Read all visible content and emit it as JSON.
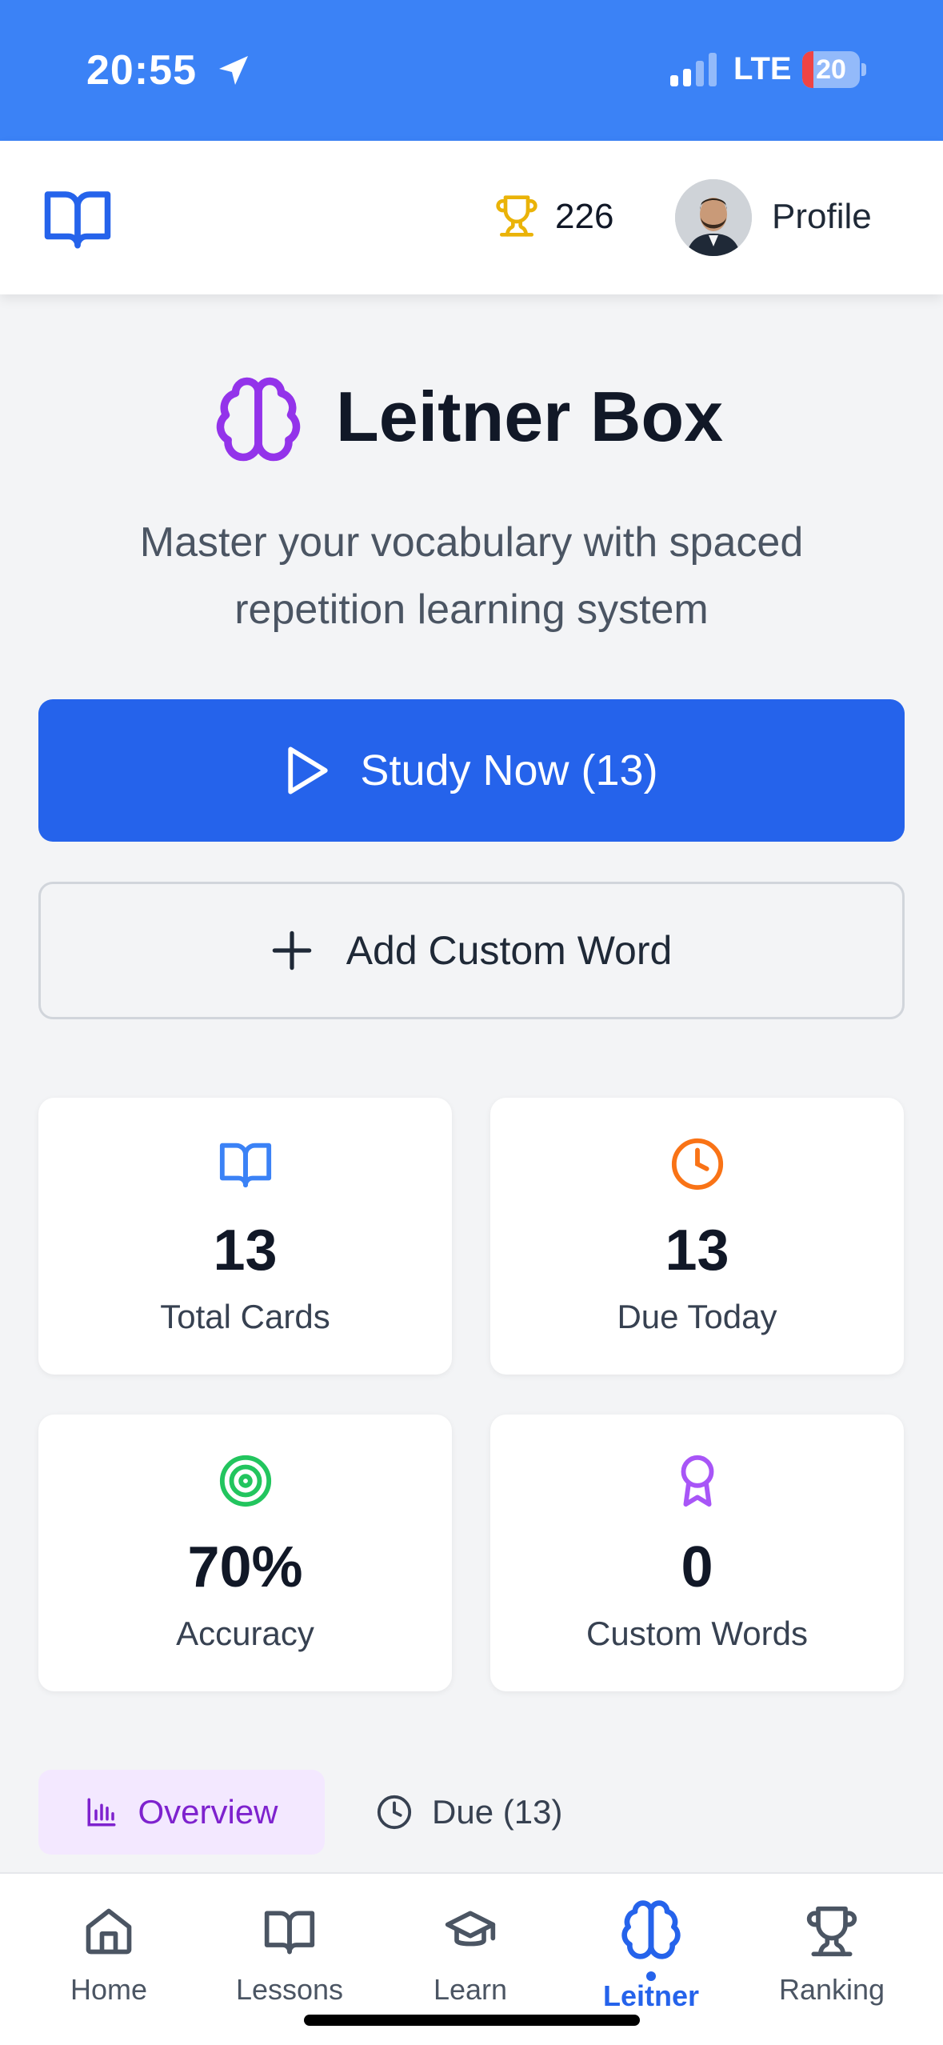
{
  "status_bar": {
    "time": "20:55",
    "network": "LTE",
    "battery": "20",
    "battery_level": 0.2,
    "background_color": "#3b82f6"
  },
  "header": {
    "logo_icon": "book-open-icon",
    "points_icon": "trophy-icon",
    "points": "226",
    "profile_label": "Profile"
  },
  "hero": {
    "icon": "brain-icon",
    "title": "Leitner Box",
    "subtitle": "Master your vocabulary with spaced repetition learning system"
  },
  "actions": {
    "study_label": "Study Now (13)",
    "study_icon": "play-icon",
    "add_label": "Add Custom Word",
    "add_icon": "plus-icon",
    "primary_color": "#2563eb"
  },
  "stats": [
    {
      "value": "13",
      "label": "Total Cards",
      "icon": "book-open-icon",
      "color": "#3b82f6"
    },
    {
      "value": "13",
      "label": "Due Today",
      "icon": "clock-icon",
      "color": "#f97316"
    },
    {
      "value": "70%",
      "label": "Accuracy",
      "icon": "target-icon",
      "color": "#22c55e"
    },
    {
      "value": "0",
      "label": "Custom Words",
      "icon": "award-icon",
      "color": "#a855f7"
    }
  ],
  "tabs": [
    {
      "label": "Overview",
      "icon": "bar-chart-icon",
      "active": true
    },
    {
      "label": "Due (13)",
      "icon": "clock-icon",
      "active": false
    }
  ],
  "nav": [
    {
      "label": "Home",
      "icon": "home-icon"
    },
    {
      "label": "Lessons",
      "icon": "book-open-icon"
    },
    {
      "label": "Learn",
      "icon": "graduation-cap-icon"
    },
    {
      "label": "Leitner",
      "icon": "brain-icon",
      "active": true
    },
    {
      "label": "Ranking",
      "icon": "trophy-icon"
    }
  ]
}
